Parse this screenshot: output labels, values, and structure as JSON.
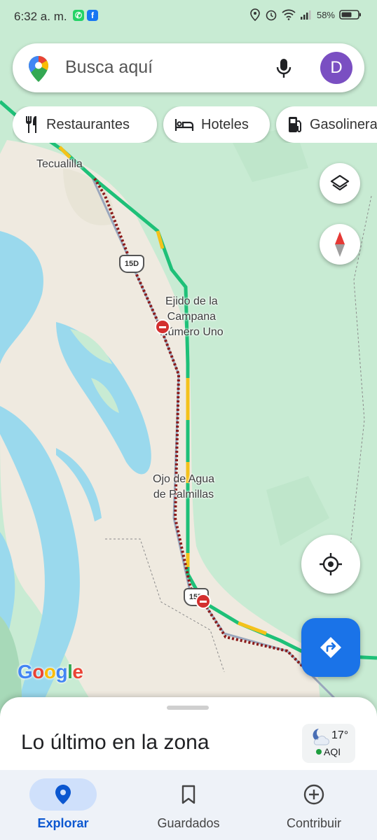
{
  "status_bar": {
    "time": "6:32 a. m.",
    "battery": "58%"
  },
  "search": {
    "placeholder": "Busca aquí",
    "avatar_initial": "D"
  },
  "chips": [
    {
      "label": "Restaurantes",
      "icon": "fork-knife-icon"
    },
    {
      "label": "Hoteles",
      "icon": "bed-icon"
    },
    {
      "label": "Gasolineras",
      "icon": "gas-station-icon"
    }
  ],
  "map": {
    "labels": {
      "tecualilla": "Tecualilla",
      "ejido": "Ejido de la\nCampana\nNúmero Uno",
      "ojo": "Ojo de Agua\nde Palmillas"
    },
    "shields": {
      "top": "15D",
      "bottom": "15D"
    },
    "attribution": "Google",
    "colors": {
      "land": "#c8ebd3",
      "water": "#9ad9ed",
      "sand": "#efeae0",
      "traffic_green": "#1ec078",
      "traffic_yellow": "#f4c21b",
      "route_closure": "#8b1a1a",
      "accent": "#1a73e8"
    }
  },
  "sheet": {
    "title": "Lo último en la zona",
    "temperature": "17°",
    "aqi_label": "AQI"
  },
  "nav": {
    "explore": "Explorar",
    "saved": "Guardados",
    "contribute": "Contribuir"
  }
}
